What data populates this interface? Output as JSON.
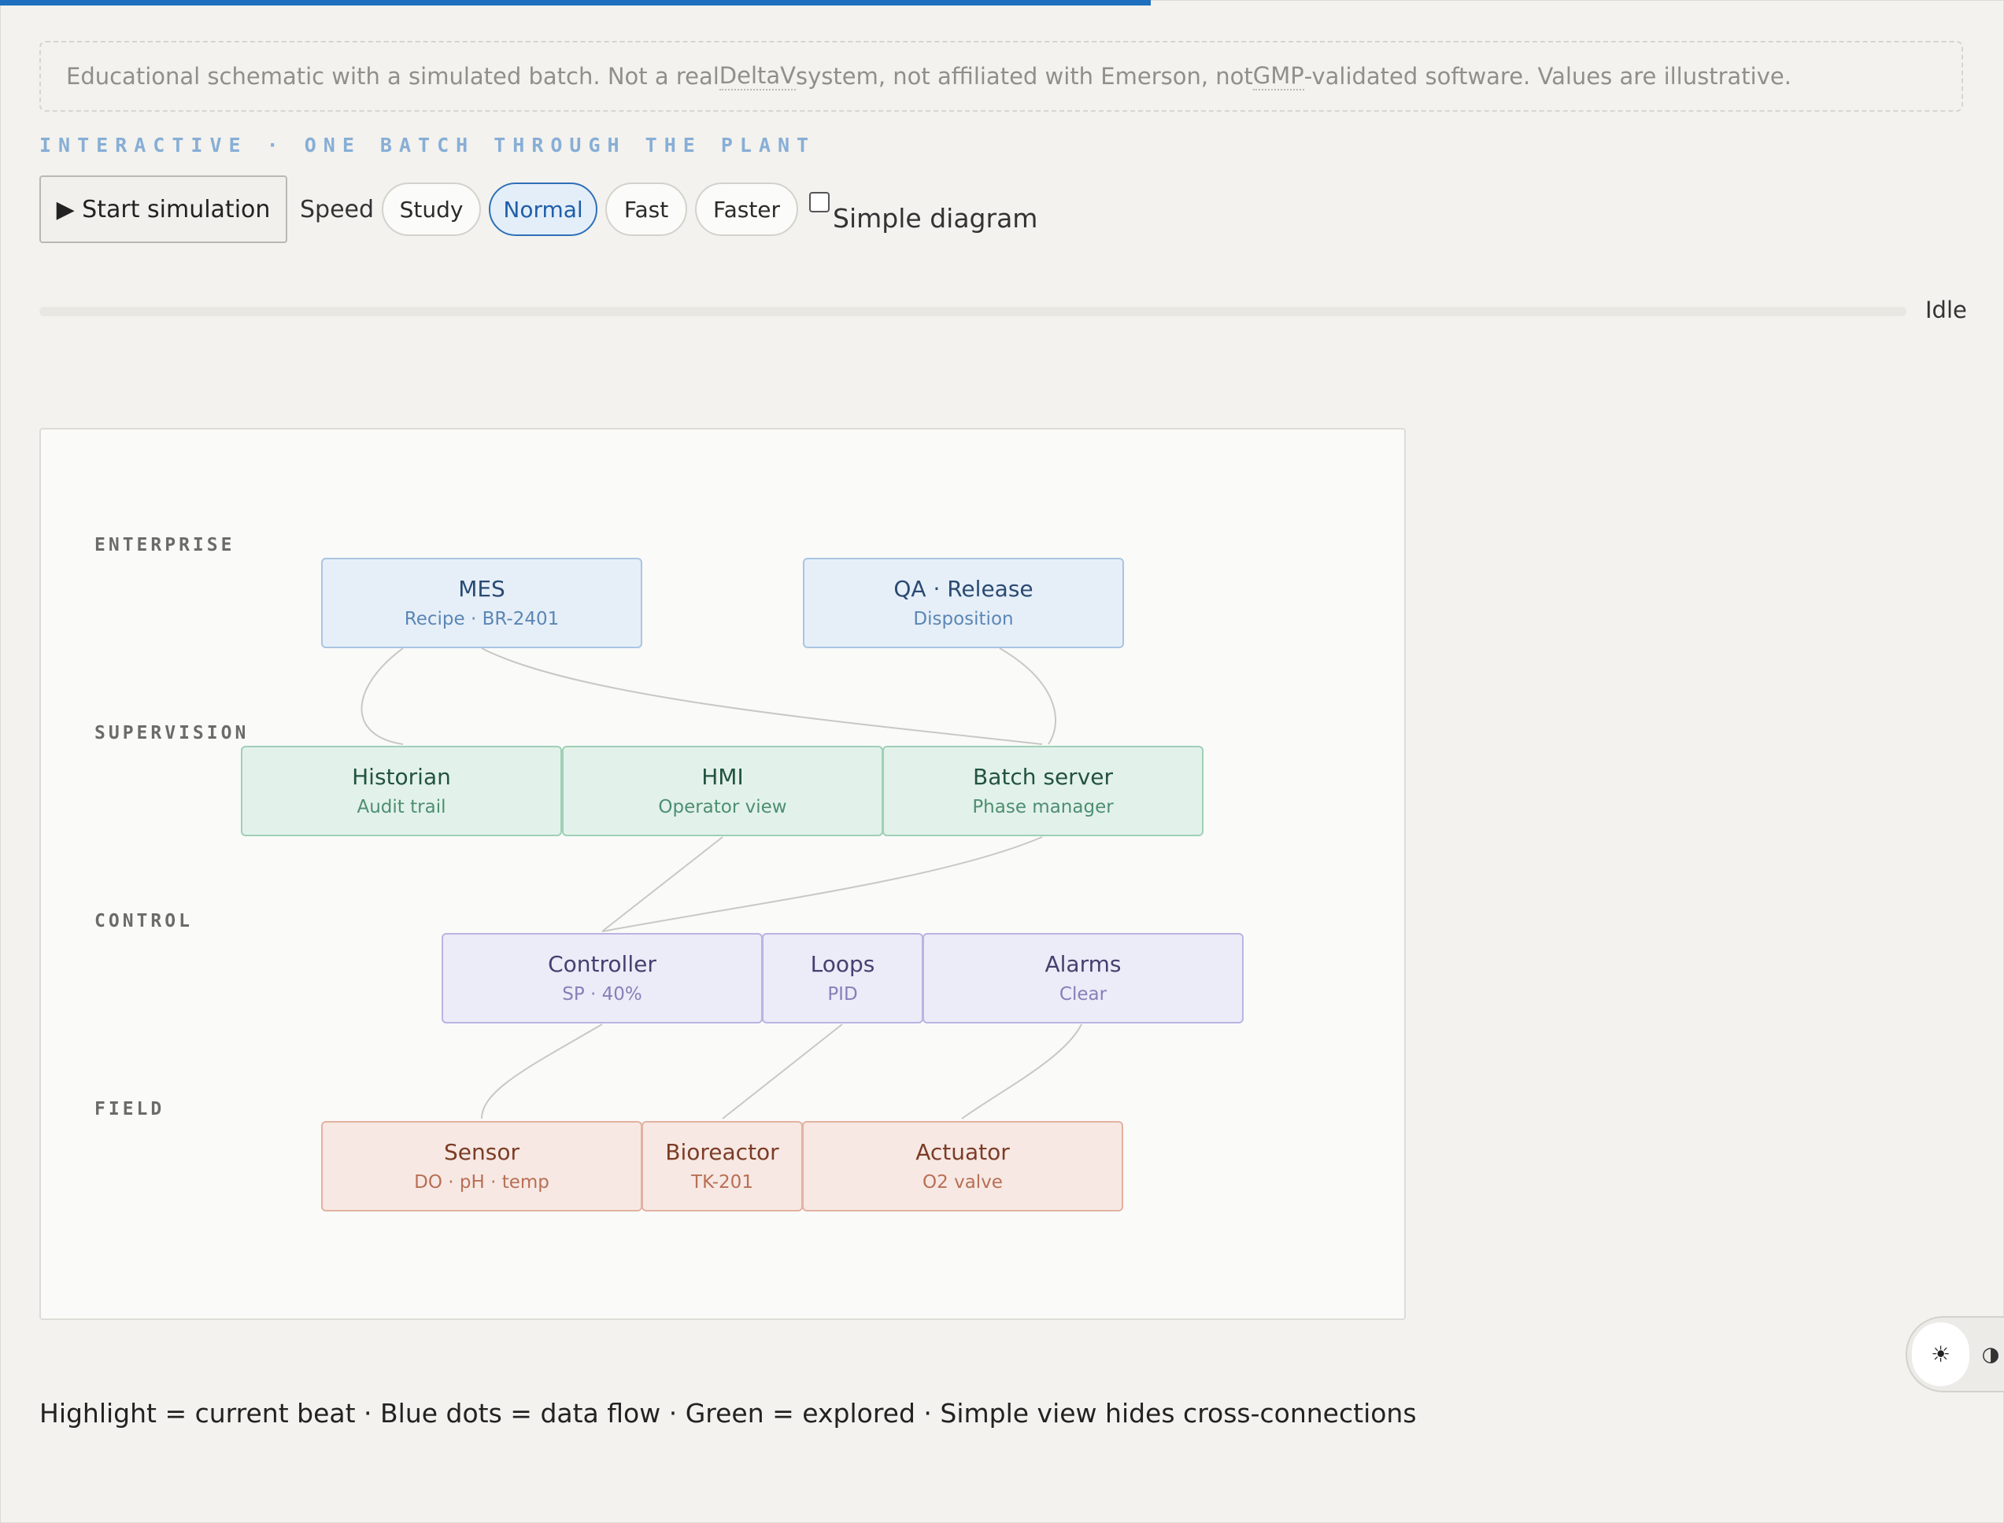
{
  "disclaimer": {
    "part1": "Educational schematic with a simulated batch. Not a real ",
    "abbr1": "DeltaV",
    "part2": " system, not affiliated with Emerson, not ",
    "abbr2": "GMP",
    "part3": "-validated software. Values are illustrative."
  },
  "section_label": "INTERACTIVE · ONE BATCH THROUGH THE PLANT",
  "controls": {
    "start_label": "▶ Start simulation",
    "speed_label": "Speed",
    "speeds": [
      "Study",
      "Normal",
      "Fast",
      "Faster"
    ],
    "selected_speed": "Normal",
    "simple_diagram_label": "Simple diagram",
    "simple_diagram_checked": false
  },
  "status": "Idle",
  "diagram": {
    "layers": [
      "ENTERPRISE",
      "SUPERVISION",
      "CONTROL",
      "FIELD"
    ],
    "nodes": {
      "mes": {
        "title": "MES",
        "sub": "Recipe · BR-2401"
      },
      "qa": {
        "title": "QA · Release",
        "sub": "Disposition"
      },
      "historian": {
        "title": "Historian",
        "sub": "Audit trail"
      },
      "hmi": {
        "title": "HMI",
        "sub": "Operator view"
      },
      "batch": {
        "title": "Batch server",
        "sub": "Phase manager"
      },
      "controller": {
        "title": "Controller",
        "sub": "SP · 40%"
      },
      "loops": {
        "title": "Loops",
        "sub": "PID"
      },
      "alarms": {
        "title": "Alarms",
        "sub": "Clear"
      },
      "sensor": {
        "title": "Sensor",
        "sub": "DO · pH · temp"
      },
      "bioreactor": {
        "title": "Bioreactor",
        "sub": "TK-201"
      },
      "actuator": {
        "title": "Actuator",
        "sub": "O2 valve"
      }
    }
  },
  "theme": {
    "light_icon": "☀",
    "dark_icon": "◑"
  },
  "legend": "Highlight = current beat · Blue dots = data flow · Green = explored · Simple view hides cross-connections",
  "colors": {
    "accent": "#1f6fbf",
    "enterprise": "#e6eff8",
    "supervision": "#e2f2ea",
    "control": "#ecebf8",
    "field": "#f7e8e3"
  }
}
